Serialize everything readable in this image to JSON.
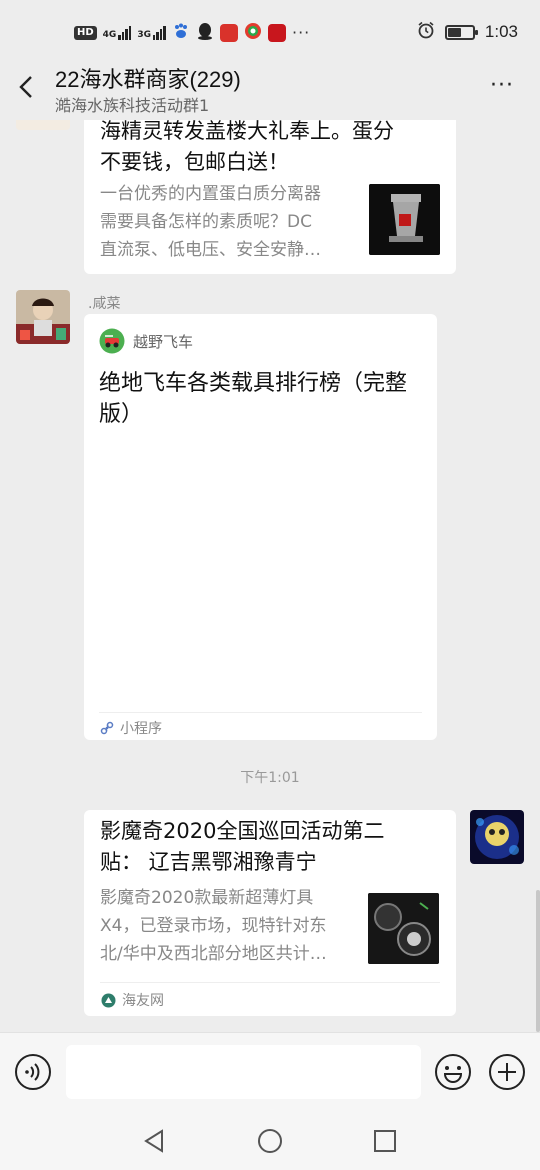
{
  "status_bar": {
    "hd": "HD",
    "net1": "4G",
    "net2": "3G",
    "dots": "···",
    "time": "1:03",
    "battery_level": 0.55
  },
  "header": {
    "title": "22海水群商家(229)",
    "subtitle": "澔海水族科技活动群1",
    "more": "···"
  },
  "messages": [
    {
      "type": "article",
      "title": "海精灵转发盖楼大礼奉上。蛋分不要钱，包邮白送！",
      "description": "一台优秀的内置蛋白质分离器需要具备怎样的素质呢？DC直流泵、低电压、安全安静…",
      "title_lines": [
        "海精灵转发盖楼大礼奉上。蛋分",
        "不要钱，包邮白送！"
      ],
      "desc_lines": [
        "一台优秀的内置蛋白质分离器",
        "需要具备怎样的素质呢？DC",
        "直流泵、低电压、安全安静…"
      ]
    },
    {
      "type": "mini_program",
      "sender": ".咸菜",
      "app_name": "越野飞车",
      "title_lines": [
        "绝地飞车各类载具排行榜（完整",
        "版）"
      ],
      "footer": "小程序"
    },
    {
      "type": "time",
      "text": "下午1:01"
    },
    {
      "type": "article",
      "title_lines": [
        "影魔奇2020全国巡回活动第二",
        "贴：  辽吉黑鄂湘豫青宁"
      ],
      "desc_lines": [
        "影魔奇2020款最新超薄灯具",
        "X4，已登录市场，现特针对东",
        "北/华中及西北部分地区共计…"
      ],
      "source": "海友网"
    }
  ],
  "input": {
    "value": "",
    "placeholder": ""
  },
  "colors": {
    "background": "#ededed",
    "card": "#ffffff",
    "gray_text": "#888888"
  }
}
